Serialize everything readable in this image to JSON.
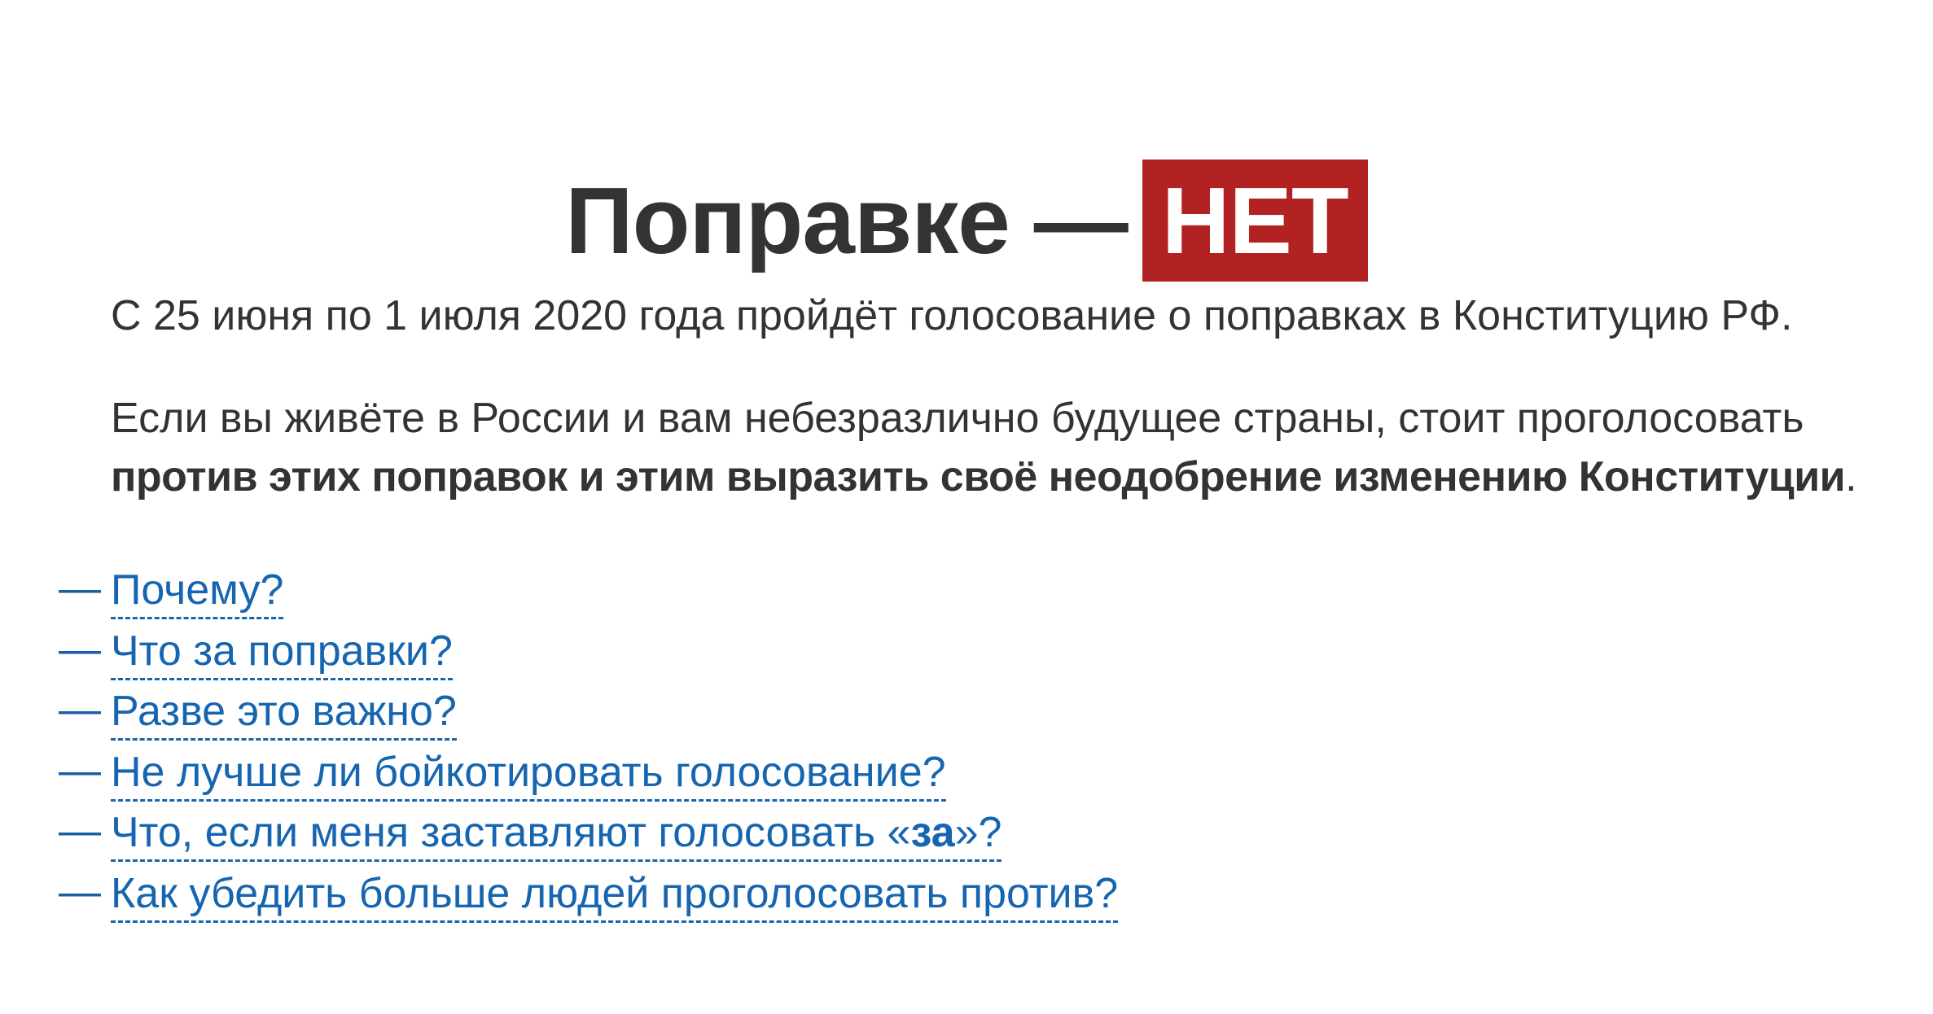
{
  "title": {
    "main": "Поправке",
    "dash": "—",
    "badge": "НЕТ"
  },
  "intro": "С 25 июня по 1 июля 2020 года пройдёт голосование о поправках в Конституцию РФ.",
  "appeal": {
    "line1": "Если вы живёте в России и вам небезразлично будущее страны, стоит проголосовать",
    "bold": "против этих поправок и этим выразить своё неодобрение изменению Конституции",
    "tail": "."
  },
  "faq": {
    "dash": "—",
    "items": [
      {
        "label": "Почему?"
      },
      {
        "label": "Что за поправки?"
      },
      {
        "label": "Разве это важно?"
      },
      {
        "label": "Не лучше ли бойкотировать голосование?"
      },
      {
        "label_before": "Что, если меня заставляют голосовать «",
        "label_bold": "за",
        "label_after": "»?"
      },
      {
        "label": "Как убедить больше людей проголосовать против?"
      }
    ]
  },
  "colors": {
    "text": "#333333",
    "badge_bg": "#b22222",
    "badge_text": "#ffffff",
    "link": "#1565b0"
  }
}
